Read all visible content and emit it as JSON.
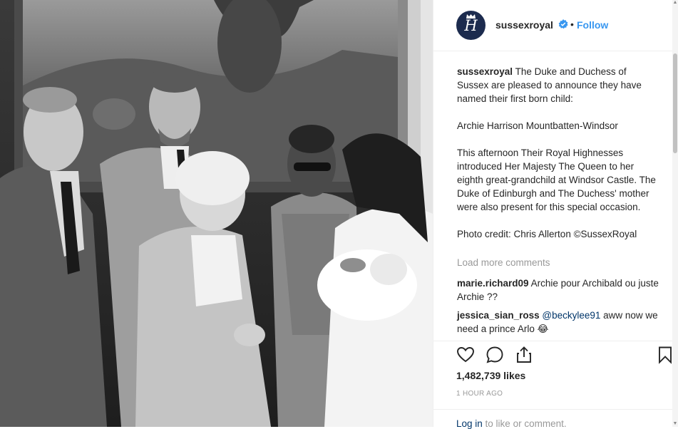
{
  "post": {
    "username": "sussexroyal",
    "avatar_letter": "H",
    "follow_separator": "•",
    "follow_label": "Follow",
    "caption_user": "sussexroyal",
    "caption_text": " The Duke and Duchess of Sussex are pleased to announce they have named their first born child:\n\nArchie Harrison Mountbatten-Windsor\n\nThis afternoon Their Royal Highnesses introduced Her Majesty The Queen to her eighth great-grandchild at Windsor Castle. The Duke of Edinburgh and The Duchess' mother were also present for this special occasion.\n\nPhoto credit: Chris Allerton ©SussexRoyal",
    "load_more_label": "Load more comments",
    "comments": [
      {
        "user": "marie.richard09",
        "text": " Archie pour Archibald ou juste Archie ??",
        "mention": ""
      },
      {
        "user": "jessica_sian_ross",
        "mention": "@beckylee91",
        "text": " aww now we need a prince Arlo 😂"
      }
    ],
    "likes": "1,482,739 likes",
    "time": "1 HOUR AGO",
    "login_link": "Log in",
    "login_rest": " to like or comment."
  },
  "colors": {
    "accent": "#3897f0",
    "verified": "#3897f0",
    "avatar_bg": "#1c2b4e",
    "secondary_text": "#999999"
  },
  "icons": {
    "verified": "verified-badge-icon",
    "like": "heart-outline-icon",
    "comment": "speech-bubble-icon",
    "share": "share-upload-icon",
    "save": "bookmark-icon"
  }
}
